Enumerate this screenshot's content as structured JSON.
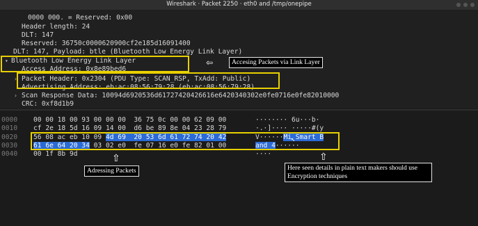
{
  "window": {
    "title": "Wireshark · Packet 2250 · eth0 and /tmp/onepipe"
  },
  "tree": {
    "reserved0": "0000 000. = Reserved: 0x00",
    "header_length": "Header length: 24",
    "dlt": "DLT: 147",
    "reserved": "Reserved: 36750c0000620900cf2e185d16091400",
    "dlt_payload": "DLT: 147, Payload: btle (Bluetooth Low Energy Link Layer)",
    "btle": "Bluetooth Low Energy Link Layer",
    "access_address": "Access Address: 0x8e89bed6",
    "packet_header": "Packet Header: 0x2304 (PDU Type: SCAN_RSP, TxAdd: Public)",
    "advertising_address": "Advertising Address: eb:ac:08:56:79:28 (eb:ac:08:56:79:28)",
    "scan_response": "Scan Response Data: 10094d6920536d61727420426616e6420340302e0fe0716e0fe82010000",
    "crc": "CRC: 0xf8d1b9"
  },
  "hex": {
    "rows": [
      {
        "offset": "0000",
        "pre": "00 00 18 00 93 00 00 00  36 75 0c 00 00 62 09 00",
        "hl": "",
        "post": "",
        "ascii_pre": "········ 6u···b·",
        "ascii_hl": "",
        "ascii_post": ""
      },
      {
        "offset": "0010",
        "pre": "cf 2e 18 5d 16 09 14 00  d6 be 89 8e 04 23 28 79",
        "hl": "",
        "post": "",
        "ascii_pre": "·.·]···· ·····#(y",
        "ascii_hl": "",
        "ascii_post": ""
      },
      {
        "offset": "0020",
        "pre": "56 08 ac eb 10 09 ",
        "hl": "4d 69  20 53 6d 61 72 74 20 42",
        "post": "",
        "ascii_pre": "V······",
        "ascii_hl": "Mi Smart B",
        "ascii_post": ""
      },
      {
        "offset": "0030",
        "pre": "",
        "hl": "61 6e 64 20 34",
        "post": " 03 02 e0  fe 07 16 e0 fe 82 01 00",
        "ascii_pre": "",
        "ascii_hl": "and 4",
        "ascii_post": "······"
      },
      {
        "offset": "0040",
        "pre": "00 1f 8b 9d",
        "hl": "",
        "post": "",
        "ascii_pre": "····",
        "ascii_hl": "",
        "ascii_post": ""
      }
    ]
  },
  "annotations": {
    "link_layer": "Accesing Packets via Link Layer",
    "addressing": "Adressing Packets",
    "plaintext": "Here seen details in plain text makers should use Encryption techniques"
  },
  "colors": {
    "highlight": "#2a6bd6",
    "box": "#e8d000"
  }
}
